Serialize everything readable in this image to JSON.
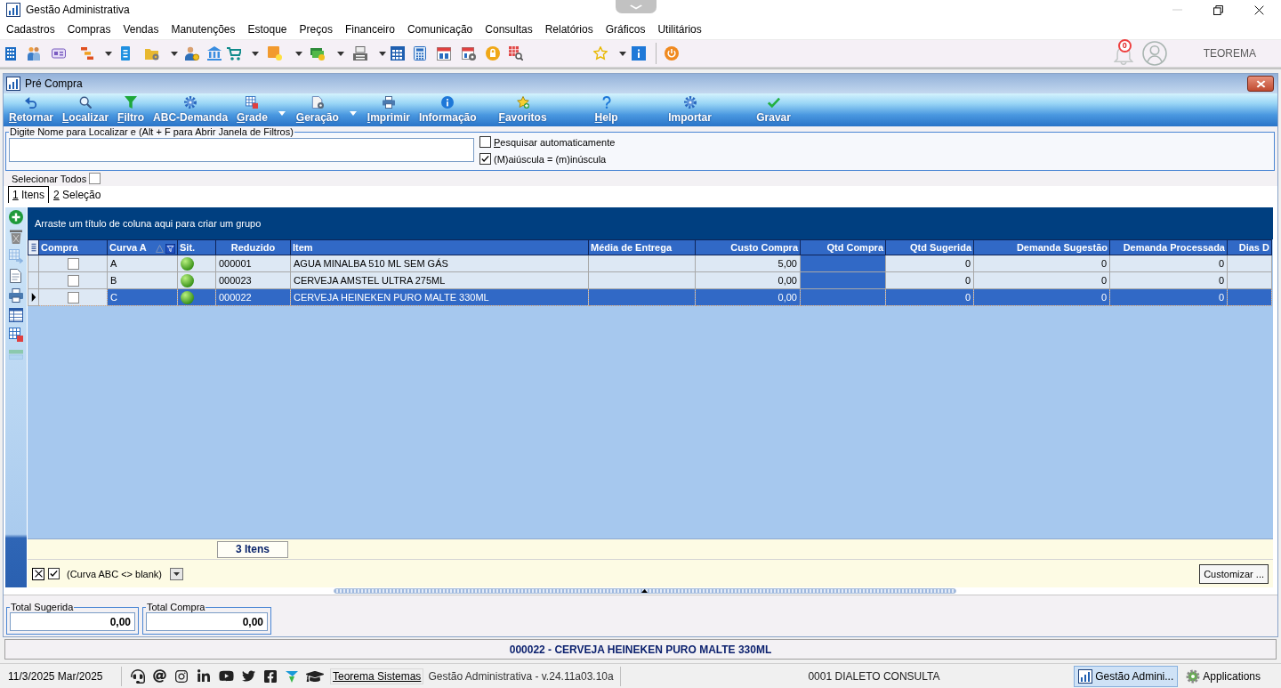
{
  "window": {
    "title": "Gestão Administrativa"
  },
  "menu": [
    "Cadastros",
    "Compras",
    "Vendas",
    "Manutenções",
    "Estoque",
    "Preços",
    "Financeiro",
    "Comunicação",
    "Consultas",
    "Relatórios",
    "Gráficos",
    "Utilitários"
  ],
  "header": {
    "notifications": "0",
    "user": "TEOREMA"
  },
  "form": {
    "title": "Pré Compra",
    "toolbar": [
      {
        "label": "Retornar",
        "mnemonic": true,
        "dropdown": false
      },
      {
        "label": "Localizar",
        "mnemonic": true,
        "dropdown": false
      },
      {
        "label": "Filtro",
        "mnemonic": true,
        "dropdown": false
      },
      {
        "label": "ABC-Demanda",
        "mnemonic": false,
        "dropdown": false
      },
      {
        "label": "Grade",
        "mnemonic": true,
        "dropdown": true
      },
      {
        "label": "Geração",
        "mnemonic": true,
        "dropdown": true
      },
      {
        "label": "Imprimir",
        "mnemonic": true,
        "dropdown": false
      },
      {
        "label": "Informação",
        "mnemonic": false,
        "dropdown": false
      },
      {
        "label": "Favoritos",
        "mnemonic": true,
        "dropdown": false
      },
      {
        "label": "Help",
        "mnemonic": true,
        "dropdown": false
      },
      {
        "label": "Importar",
        "mnemonic": false,
        "dropdown": false
      },
      {
        "label": "Gravar",
        "mnemonic": false,
        "dropdown": false
      }
    ],
    "search": {
      "legend": "Digite Nome para Localizar e (Alt + F para Abrir Janela de Filtros)",
      "options": [
        {
          "label": "Pesquisar automaticamente",
          "checked": false,
          "mnemonic": true
        },
        {
          "label": "(M)aiúscula = (m)inúscula",
          "checked": true,
          "mnemonic": false
        }
      ]
    },
    "select_all": {
      "label": "Selecionar Todos",
      "checked": false
    },
    "tabs": [
      {
        "label": "1 Itens",
        "selected": true,
        "mnemonic": true
      },
      {
        "label": "2 Seleção",
        "selected": false,
        "mnemonic": true
      }
    ],
    "grid": {
      "group_panel": "Arraste um título de coluna aqui para criar um grupo",
      "columns": [
        {
          "label": "Compra",
          "kind": "check",
          "highlighted": false,
          "filtered": false,
          "sorted": false
        },
        {
          "label": "Curva A",
          "kind": "text",
          "highlighted": false,
          "filtered": true,
          "sorted": true
        },
        {
          "label": "Sit.",
          "kind": "status",
          "highlighted": false,
          "filtered": false,
          "sorted": false
        },
        {
          "label": "Reduzido",
          "kind": "code",
          "highlighted": false,
          "filtered": false,
          "sorted": false,
          "summary": "3 Itens"
        },
        {
          "label": "Item",
          "kind": "text",
          "highlighted": false,
          "filtered": false,
          "sorted": false
        },
        {
          "label": "Média de Entrega",
          "kind": "text",
          "highlighted": false,
          "filtered": false,
          "sorted": false
        },
        {
          "label": "Custo Compra",
          "kind": "number",
          "highlighted": false,
          "filtered": false,
          "sorted": false
        },
        {
          "label": "Qtd Compra",
          "kind": "number",
          "highlighted": true,
          "filtered": false,
          "sorted": false
        },
        {
          "label": "Qtd Sugerida",
          "kind": "number",
          "highlighted": false,
          "filtered": false,
          "sorted": false
        },
        {
          "label": "Demanda Sugestão",
          "kind": "number",
          "highlighted": false,
          "filtered": false,
          "sorted": false
        },
        {
          "label": "Demanda Processada",
          "kind": "number",
          "highlighted": false,
          "filtered": false,
          "sorted": false
        },
        {
          "label": "Dias D",
          "kind": "number",
          "highlighted": false,
          "filtered": false,
          "sorted": false
        }
      ],
      "rows": [
        {
          "selected": false,
          "checked": false,
          "cells": [
            "",
            "A",
            "",
            "000001",
            "AGUA MINALBA 510 ML SEM GÁS",
            "",
            "5,00",
            "",
            "0",
            "0",
            "0",
            ""
          ]
        },
        {
          "selected": false,
          "checked": false,
          "cells": [
            "",
            "B",
            "",
            "000023",
            "CERVEJA AMSTEL ULTRA 275ML",
            "",
            "0,00",
            "",
            "0",
            "0",
            "0",
            ""
          ]
        },
        {
          "selected": true,
          "checked": false,
          "cells": [
            "",
            "C",
            "",
            "000022",
            "CERVEJA HEINEKEN PURO MALTE 330ML",
            "",
            "0,00",
            "",
            "0",
            "0",
            "0",
            ""
          ]
        }
      ],
      "filter": {
        "enabled": true,
        "text": "(Curva ABC <> blank)"
      },
      "customize": "Customizar ..."
    },
    "totals": [
      {
        "label": "Total Sugerida",
        "value": "0,00"
      },
      {
        "label": "Total Compra",
        "value": "0,00"
      }
    ]
  },
  "current_item": "000022 - CERVEJA HEINEKEN PURO MALTE 330ML",
  "status_bar": {
    "date": "11/3/2025 Mar/2025",
    "link": "Teorema Sistemas",
    "version": "Gestão Administrativa - v.24.11a03.10a",
    "company": "0001 DIALETO CONSULTA",
    "tasks": [
      {
        "label": "Gestão Admini...",
        "selected": true
      },
      {
        "label": "Applications",
        "selected": false
      }
    ]
  }
}
